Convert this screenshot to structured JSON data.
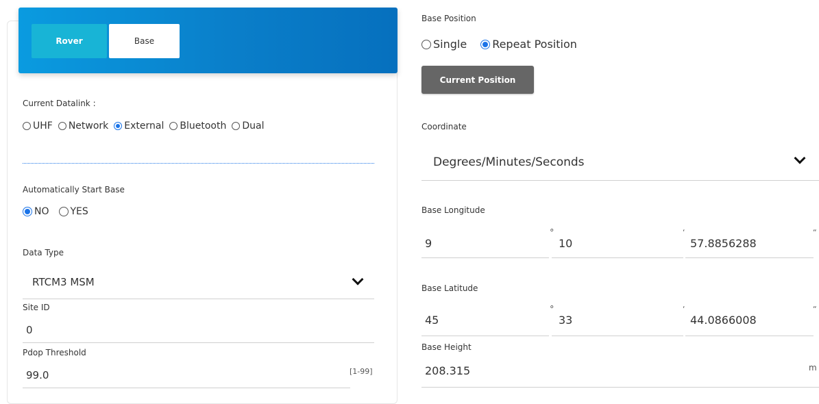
{
  "tabs": {
    "rover": "Rover",
    "base": "Base"
  },
  "datalink": {
    "label": "Current Datalink :",
    "options": [
      "UHF",
      "Network",
      "External",
      "Bluetooth",
      "Dual"
    ],
    "selected": "External"
  },
  "auto_start": {
    "label": "Automatically Start Base",
    "options": [
      "NO",
      "YES"
    ],
    "selected": "NO"
  },
  "data_type": {
    "label": "Data Type",
    "value": "RTCM3 MSM"
  },
  "site_id": {
    "label": "Site ID",
    "value": "0"
  },
  "pdop": {
    "label": "Pdop Threshold",
    "value": "99.0",
    "range": "[1-99]"
  },
  "base_position": {
    "label": "Base Position",
    "options": [
      "Single",
      "Repeat Position"
    ],
    "selected": "Repeat Position",
    "current_button": "Current Position"
  },
  "coordinate": {
    "label": "Coordinate",
    "value": "Degrees/Minutes/Seconds"
  },
  "longitude": {
    "label": "Base Longitude",
    "deg": "9",
    "min": "10",
    "sec": "57.8856288"
  },
  "latitude": {
    "label": "Base Latitude",
    "deg": "45",
    "min": "33",
    "sec": "44.0866008"
  },
  "height": {
    "label": "Base Height",
    "value": "208.315",
    "unit": "m"
  },
  "symbols": {
    "degree": "°",
    "minute": "‘",
    "second": "“"
  }
}
